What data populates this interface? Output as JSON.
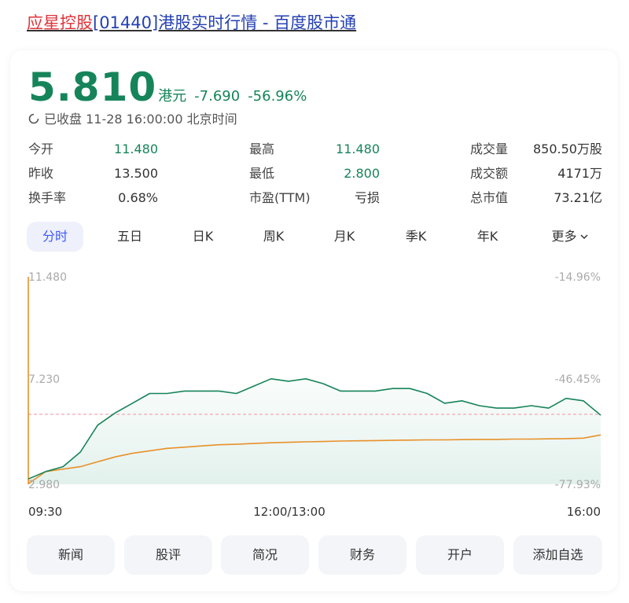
{
  "header": {
    "title_highlight": "应星控股",
    "title_rest": "[01440]港股实时行情 - 百度股市通"
  },
  "quote": {
    "price": "5.810",
    "unit": "港元",
    "change": "-7.690",
    "change_pct": "-56.96%",
    "status": "已收盘 11-28 16:00:00 北京时间"
  },
  "stats": [
    {
      "label": "今开",
      "value": "11.480"
    },
    {
      "label": "最高",
      "value": "11.480"
    },
    {
      "label": "成交量",
      "value": "850.50万股"
    },
    {
      "label": "昨收",
      "value": "13.500"
    },
    {
      "label": "最低",
      "value": "2.800"
    },
    {
      "label": "成交额",
      "value": "4171万"
    },
    {
      "label": "换手率",
      "value": "0.68%"
    },
    {
      "label": "市盈(TTM)",
      "value": "亏损"
    },
    {
      "label": "总市值",
      "value": "73.21亿"
    }
  ],
  "tabs": [
    "分时",
    "五日",
    "日K",
    "周K",
    "月K",
    "季K",
    "年K",
    "更多"
  ],
  "active_tab": 0,
  "chart_labels": {
    "y_top": "11.480",
    "y_mid": "7.230",
    "y_bottom": "2.980",
    "pct_top": "-14.96%",
    "pct_mid": "-46.45%",
    "pct_bottom": "-77.93%",
    "x_start": "09:30",
    "x_mid": "12:00/13:00",
    "x_end": "16:00"
  },
  "buttons": [
    "新闻",
    "股评",
    "简况",
    "财务",
    "开户",
    "添加自选"
  ],
  "colors": {
    "down": "#16845a",
    "avg_line": "#e8912a",
    "prev_close_line": "#f1a8ae",
    "accent": "#3d5afe"
  },
  "chart_data": {
    "type": "line",
    "ylim": [
      2.98,
      11.48
    ],
    "prev_close": 13.5,
    "x": [
      "09:30",
      "09:40",
      "09:50",
      "10:00",
      "10:10",
      "10:20",
      "10:30",
      "10:40",
      "10:50",
      "11:00",
      "11:10",
      "11:20",
      "11:30",
      "11:40",
      "11:50",
      "12:00/13:00",
      "13:10",
      "13:20",
      "13:30",
      "13:40",
      "13:50",
      "14:00",
      "14:10",
      "14:20",
      "14:30",
      "14:40",
      "14:50",
      "15:00",
      "15:10",
      "15:20",
      "15:30",
      "15:40",
      "15:50",
      "16:00"
    ],
    "series": [
      {
        "values": [
          3.2,
          3.5,
          3.7,
          4.3,
          5.4,
          5.9,
          6.3,
          6.7,
          6.7,
          6.8,
          6.8,
          6.8,
          6.7,
          7.0,
          7.3,
          7.2,
          7.3,
          7.1,
          6.8,
          6.8,
          6.8,
          6.9,
          6.9,
          6.7,
          6.3,
          6.4,
          6.2,
          6.1,
          6.1,
          6.2,
          6.1,
          6.5,
          6.4,
          5.81
        ]
      },
      {
        "values": [
          3.0,
          3.5,
          3.6,
          3.7,
          3.9,
          4.1,
          4.25,
          4.35,
          4.45,
          4.5,
          4.55,
          4.6,
          4.62,
          4.65,
          4.68,
          4.7,
          4.72,
          4.73,
          4.75,
          4.76,
          4.77,
          4.78,
          4.79,
          4.8,
          4.8,
          4.81,
          4.82,
          4.82,
          4.83,
          4.83,
          4.84,
          4.85,
          4.87,
          5.0
        ]
      }
    ]
  }
}
